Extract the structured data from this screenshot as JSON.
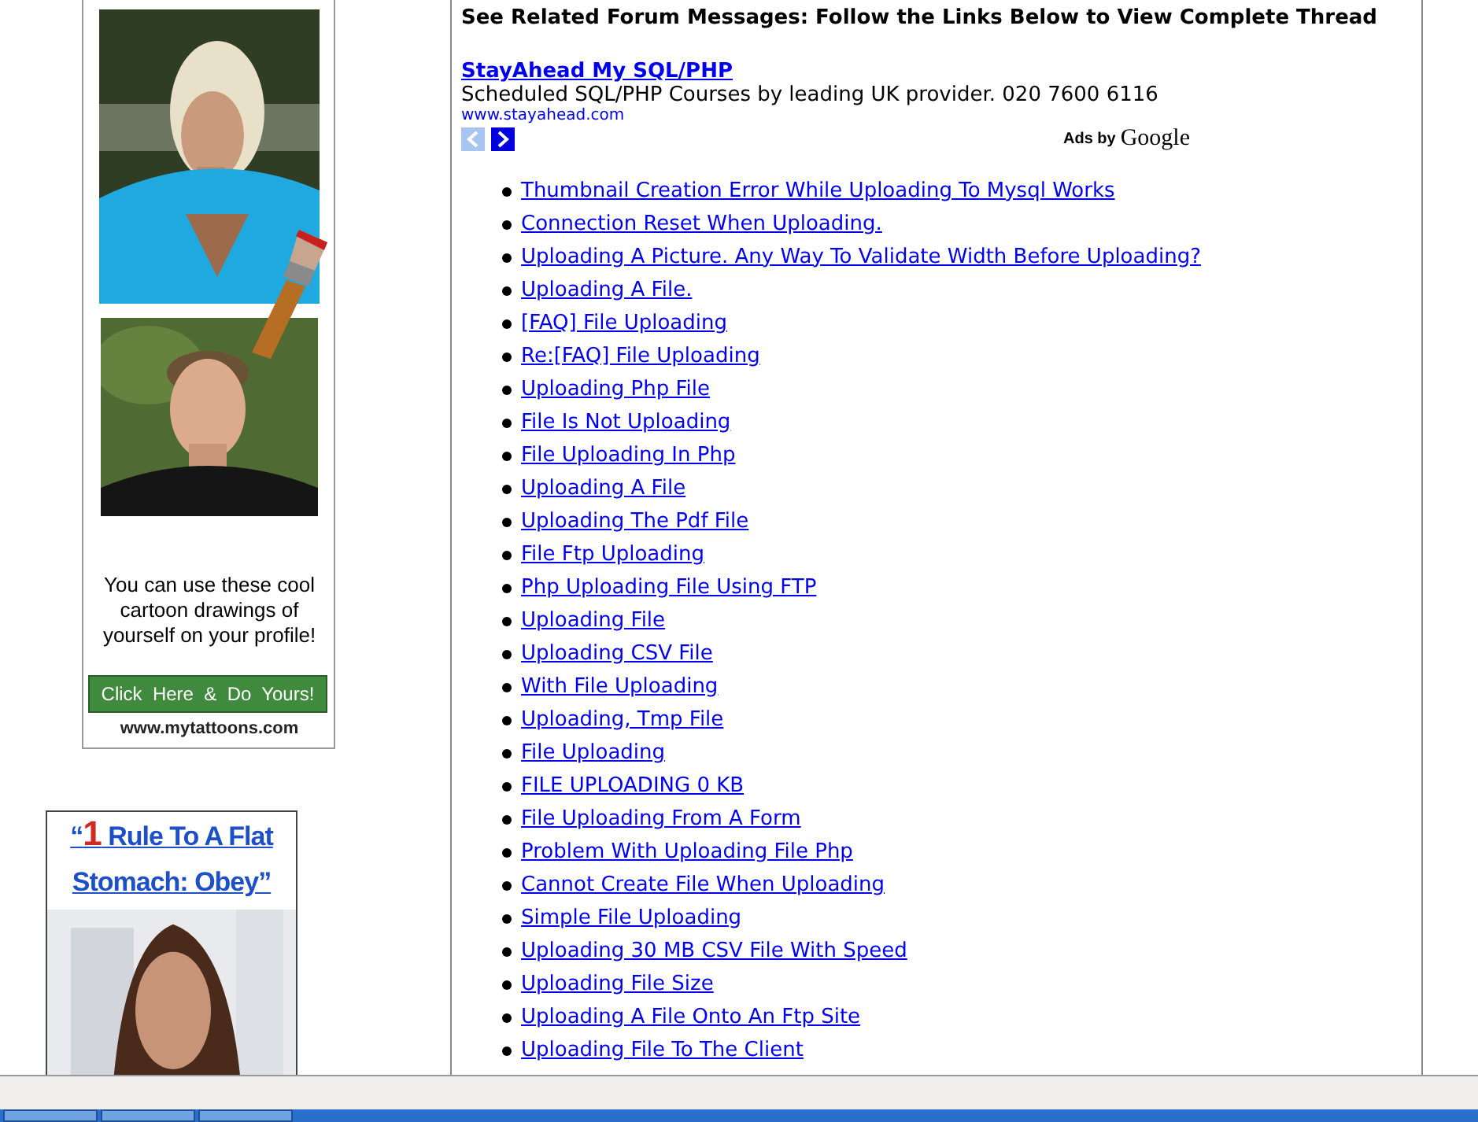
{
  "left_ads": {
    "cartoon_ad": {
      "caption": "You can use these cool cartoon drawings of yourself on your profile!",
      "button": "Click  Here  &  Do  Yours!",
      "site": "www.mytattoons.com"
    },
    "stomach_ad": {
      "quote_open": "“",
      "number": "1",
      "headline": "Rule To A Flat Stomach: Obey”"
    }
  },
  "main": {
    "heading": "See Related Forum Messages: Follow the Links Below to View Complete Thread",
    "text_ad": {
      "title": "StayAhead My SQL/PHP",
      "description": "Scheduled SQL/PHP Courses by leading UK provider. 020 7600 6116",
      "url": "www.stayahead.com",
      "ads_by": "Ads by",
      "brand": "Google",
      "nav": [
        {
          "kind": "prev",
          "disabled": true
        },
        {
          "kind": "next",
          "disabled": false
        }
      ]
    },
    "links": [
      "Thumbnail Creation Error While Uploading To Mysql Works",
      "Connection Reset When Uploading.",
      "Uploading A Picture. Any Way To Validate Width Before Uploading?",
      "Uploading A File.",
      "[FAQ] File Uploading",
      "Re:[FAQ] File Uploading",
      "Uploading Php File",
      "File Is Not Uploading",
      "File Uploading In Php",
      "Uploading A File",
      "Uploading The Pdf File",
      "File Ftp Uploading",
      "Php Uploading File Using FTP",
      "Uploading File",
      "Uploading CSV File",
      "With File Uploading",
      "Uploading, Tmp File",
      "File Uploading",
      "FILE UPLOADING 0 KB",
      "File Uploading From A Form",
      "Problem With Uploading File Php",
      "Cannot Create File When Uploading",
      "Simple File Uploading",
      "Uploading 30 MB CSV File With Speed",
      "Uploading File Size",
      "Uploading A File Onto An Ftp Site",
      "Uploading File To The Client"
    ]
  }
}
